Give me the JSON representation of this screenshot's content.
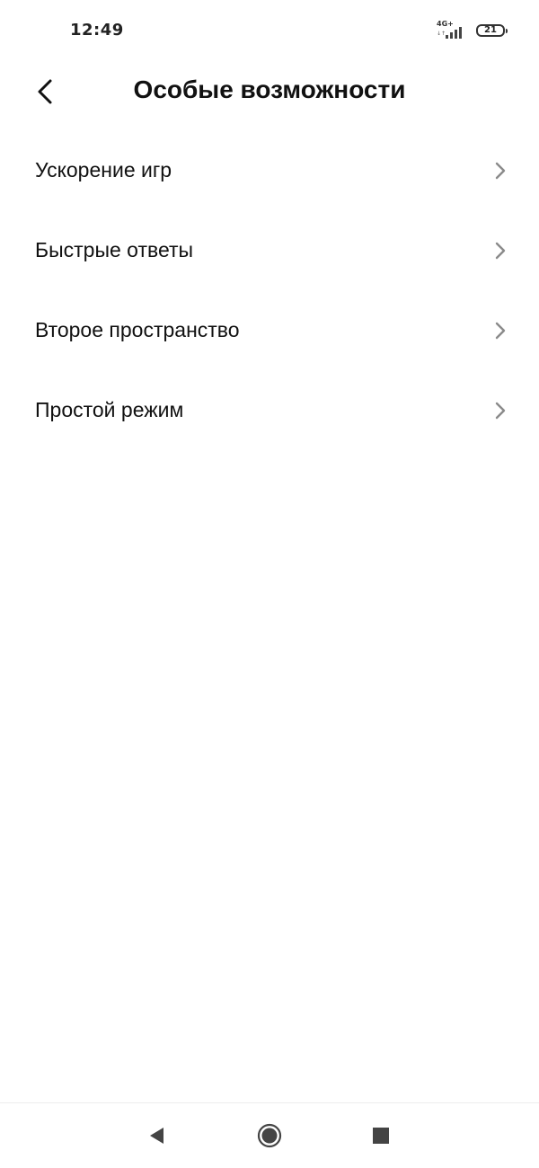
{
  "status_bar": {
    "time": "12:49",
    "network_type": "4G+",
    "signal_bars": 4,
    "battery_level": "21"
  },
  "header": {
    "title": "Особые возможности",
    "back_icon": "chevron-left-icon"
  },
  "menu": {
    "items": [
      {
        "label": "Ускорение игр",
        "icon": "chevron-right-icon"
      },
      {
        "label": "Быстрые ответы",
        "icon": "chevron-right-icon"
      },
      {
        "label": "Второе пространство",
        "icon": "chevron-right-icon"
      },
      {
        "label": "Простой режим",
        "icon": "chevron-right-icon"
      }
    ]
  },
  "navigation_bar": {
    "back_icon": "triangle-back-icon",
    "home_icon": "circle-home-icon",
    "recents_icon": "square-recents-icon"
  },
  "colors": {
    "background": "#ffffff",
    "text": "#111111",
    "chevron": "#8a8a8a",
    "nav_icons": "#444444"
  }
}
